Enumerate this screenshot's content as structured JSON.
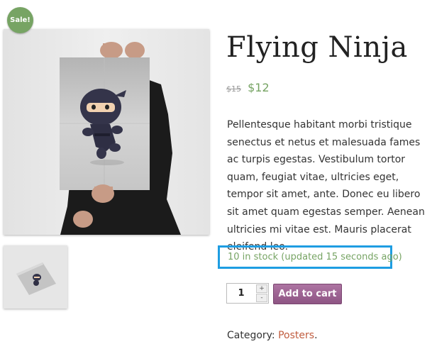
{
  "badge": {
    "sale": "Sale!"
  },
  "product": {
    "title": "Flying Ninja",
    "old_price": "$15",
    "price": "$12",
    "description": "Pellentesque habitant morbi tristique senectus et netus et malesuada fames ac turpis egestas. Vestibulum tortor quam, feugiat vitae, ultricies eget, tempor sit amet, ante. Donec eu libero sit amet quam egestas semper. Aenean ultricies mi vitae est. Mauris placerat eleifend leo.",
    "stock": "10 in stock (updated 15 seconds ago)"
  },
  "cart": {
    "quantity": "1",
    "plus": "+",
    "minus": "-",
    "add_label": "Add to cart"
  },
  "meta": {
    "category_label": "Category: ",
    "category_link": "Posters",
    "category_suffix": "."
  },
  "colors": {
    "accent_green": "#77a464",
    "button_purple": "#9b6291",
    "highlight_blue": "#1e9de2",
    "link": "#c15d3f"
  }
}
